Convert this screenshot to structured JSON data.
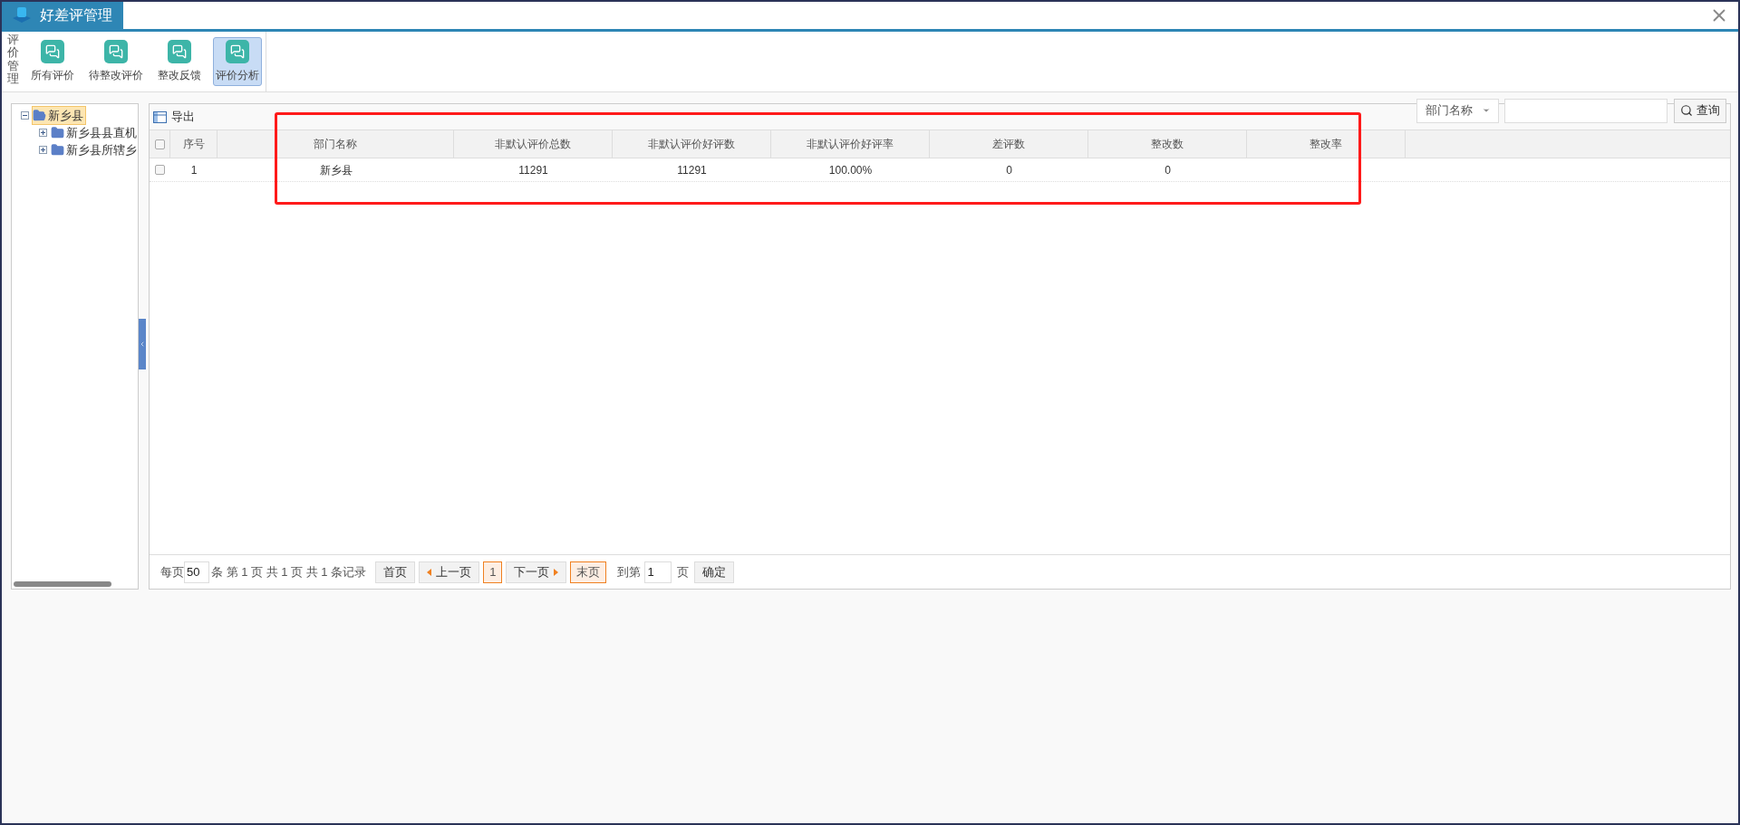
{
  "window": {
    "title": "好差评管理"
  },
  "toolbar": {
    "group_label": "评价管理",
    "buttons": [
      {
        "label": "所有评价",
        "selected": false
      },
      {
        "label": "待整改评价",
        "selected": false
      },
      {
        "label": "整改反馈",
        "selected": false
      },
      {
        "label": "评价分析",
        "selected": true
      }
    ]
  },
  "tree": [
    {
      "label": "新乡县",
      "expanded": true,
      "selected": true,
      "children": [
        {
          "label": "新乡县县直机",
          "expanded": false,
          "selected": false
        },
        {
          "label": "新乡县所辖乡",
          "expanded": false,
          "selected": false
        }
      ]
    }
  ],
  "grid": {
    "export_label": "导出",
    "select_all_checked": false,
    "filter": {
      "field": "部门名称",
      "button": "查询"
    },
    "columns": [
      "序号",
      "部门名称",
      "非默认评价总数",
      "非默认评价好评数",
      "非默认评价好评率",
      "差评数",
      "整改数",
      "整改率"
    ],
    "rows": [
      {
        "selected": false,
        "cells": [
          "1",
          "新乡县",
          "11291",
          "11291",
          "100.00%",
          "0",
          "0"
        ]
      }
    ]
  },
  "pagination": {
    "per_page_label": "每页",
    "per_page": "50",
    "summary": "条 第 1 页 共 1 页 共 1 条记录",
    "first": "首页",
    "prev": "上一页",
    "current": "1",
    "next": "下一页",
    "last": "末页",
    "goto_label": "到第",
    "goto_value": "1",
    "goto_unit": "页",
    "confirm": "确定"
  }
}
